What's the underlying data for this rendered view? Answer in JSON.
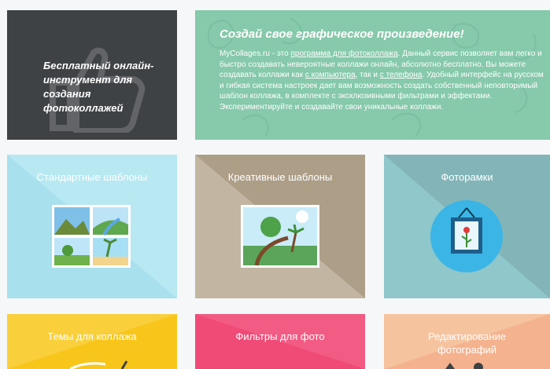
{
  "hero": {
    "lines": [
      "Бесплатный онлайн-",
      "инструмент для",
      "создания",
      "фотоколлажей"
    ]
  },
  "intro": {
    "title": "Создай свое графическое произведение!",
    "p1": "MyCollages.ru - это ",
    "link1": "программа для фотоколлажа",
    "p2": ". Данный сервис позволяет вам легко и быстро создавать невероятные коллажи онлайн, абсолютно бесплатно. Вы можете создавать коллажи как ",
    "link2": "с компьютера",
    "p3": ", так и ",
    "link3": "с телефона",
    "p4": ". Удобный интерфейс на русском и гибкая система настроек дает вам возможность создать собственный неповторимый шаблон коллажа, в комплекте с эксклюзивными фильтрами и эффектами. Экспериментируйте и создавайте свои уникальные коллажи."
  },
  "cards": {
    "standard": "Стандартные шаблоны",
    "creative": "Креативные шаблоны",
    "frames": "Фоторамки",
    "themes": "Темы для коллажа",
    "filters": "Фильтры для фото",
    "editing_line1": "Редактирование",
    "editing_line2": "фотографий"
  },
  "icons": [
    "thumbs-up-icon",
    "collage-grid-icon",
    "photo-icon",
    "picture-frame-icon"
  ]
}
